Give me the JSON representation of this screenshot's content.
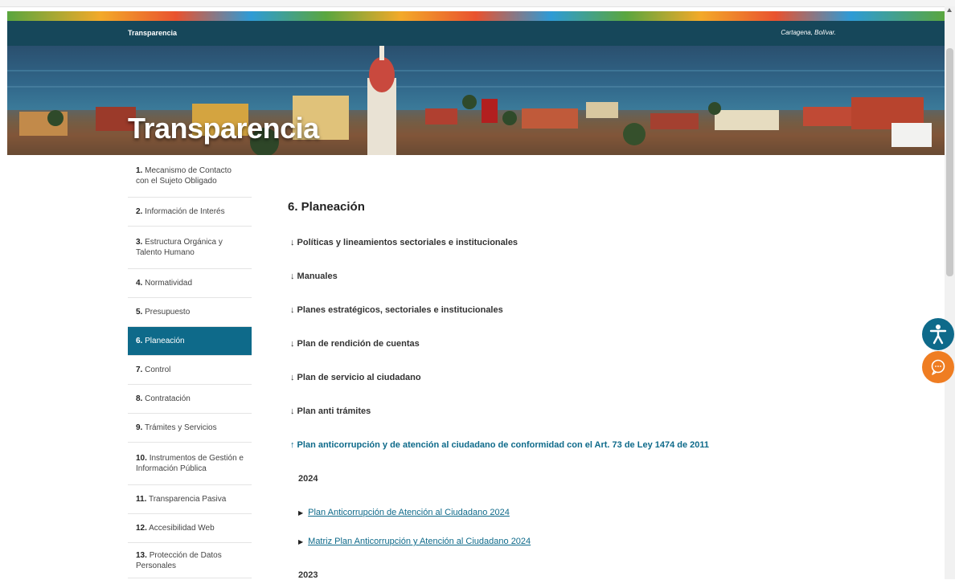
{
  "header": {
    "brand": "Transparencia",
    "location": "Cartagena, Bolívar."
  },
  "hero": {
    "title": "Transparencia"
  },
  "sidebar": {
    "items": [
      {
        "num": "1.",
        "label": "Mecanismo de Contacto con el Sujeto Obligado",
        "active": false
      },
      {
        "num": "2.",
        "label": "Información de Interés",
        "active": false
      },
      {
        "num": "3.",
        "label": "Estructura Orgánica y Talento Humano",
        "active": false
      },
      {
        "num": "4.",
        "label": "Normatividad",
        "active": false
      },
      {
        "num": "5.",
        "label": "Presupuesto",
        "active": false
      },
      {
        "num": "6.",
        "label": "Planeación",
        "active": true
      },
      {
        "num": "7.",
        "label": "Control",
        "active": false
      },
      {
        "num": "8.",
        "label": "Contratación",
        "active": false
      },
      {
        "num": "9.",
        "label": "Trámites y Servicios",
        "active": false
      },
      {
        "num": "10.",
        "label": "Instrumentos de Gestión e Información Pública",
        "active": false
      },
      {
        "num": "11.",
        "label": "Transparencia Pasiva",
        "active": false
      },
      {
        "num": "12.",
        "label": "Accesibilidad Web",
        "active": false
      },
      {
        "num": "13.",
        "label": "Protección de Datos Personales",
        "active": false
      }
    ]
  },
  "content": {
    "heading": "6. Planeación",
    "sections": [
      {
        "label": "↓ Políticas y lineamientos sectoriales e institucionales",
        "open": false
      },
      {
        "label": "↓ Manuales",
        "open": false
      },
      {
        "label": "↓ Planes estratégicos, sectoriales e institucionales",
        "open": false
      },
      {
        "label": "↓ Plan de rendición de cuentas",
        "open": false
      },
      {
        "label": "↓ Plan de servicio al ciudadano",
        "open": false
      },
      {
        "label": "↓ Plan anti trámites",
        "open": false
      },
      {
        "label": "↑ Plan anticorrupción y de atención al ciudadano de conformidad con el Art. 73 de Ley 1474 de 2011",
        "open": true
      }
    ],
    "years": [
      {
        "year": "2024",
        "docs": [
          "Plan Anticorrupción de Atención al Ciudadano 2024",
          "Matriz Plan Anticorrupción y Atención al Ciudadano 2024"
        ]
      },
      {
        "year": "2023",
        "docs": []
      }
    ]
  },
  "widgets": {
    "accessibility_icon": "accessibility-person-icon",
    "chat_icon": "chat-bubble-icon",
    "accessibility_color": "#0e6a8a",
    "chat_color": "#ef7d22"
  }
}
